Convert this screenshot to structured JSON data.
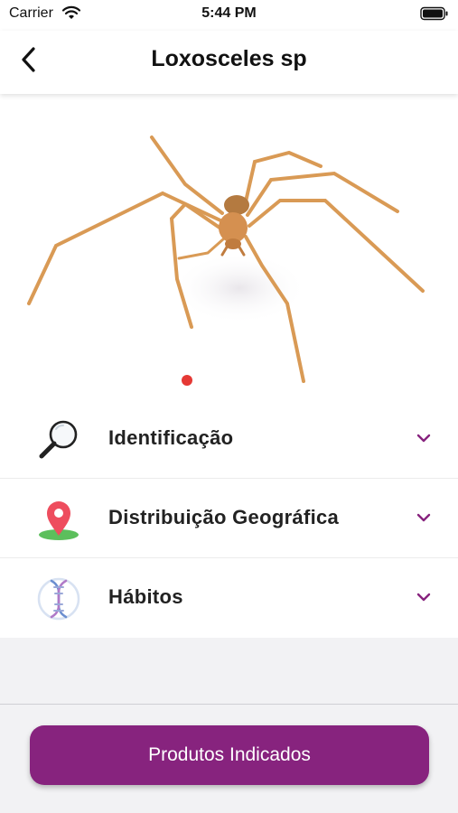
{
  "status_bar": {
    "carrier": "Carrier",
    "time": "5:44 PM",
    "icons": [
      "wifi-icon",
      "battery-icon"
    ]
  },
  "nav": {
    "title": "Loxosceles sp",
    "back_icon": "chevron-left-icon"
  },
  "hero": {
    "image": "spider-photo",
    "pager": {
      "count": 1,
      "active_index": 0,
      "active_color": "#e53935"
    }
  },
  "sections": [
    {
      "label": "Identificação",
      "icon": "magnifier-icon",
      "expanded": false
    },
    {
      "label": "Distribuição Geográfica",
      "icon": "map-pin-icon",
      "expanded": false
    },
    {
      "label": "Hábitos",
      "icon": "dna-icon",
      "expanded": false
    }
  ],
  "cta": {
    "label": "Produtos Indicados"
  },
  "colors": {
    "accent": "#87237e",
    "chevron": "#87237e",
    "pin": "#ee4d5e",
    "pin_base": "#5cbf5c"
  }
}
